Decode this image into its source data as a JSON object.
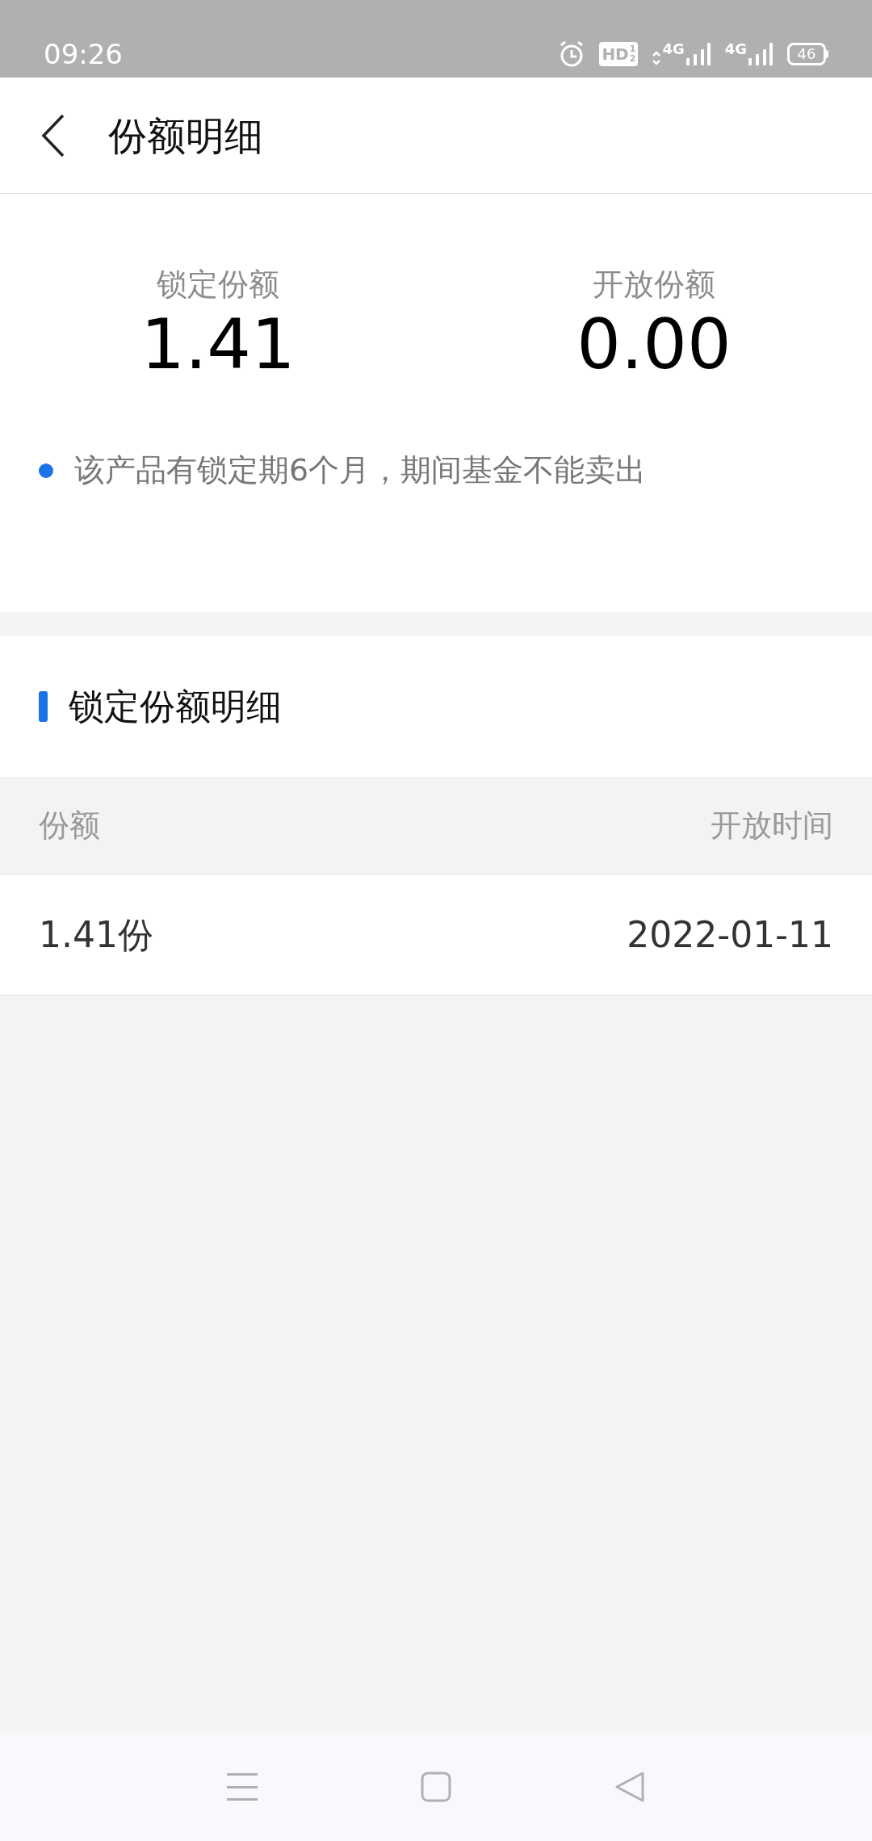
{
  "status_bar": {
    "time": "09:26",
    "hd_badge": "HD",
    "hd_sims": [
      "1",
      "2"
    ],
    "networks": [
      "4G",
      "4G"
    ],
    "battery": "46"
  },
  "header": {
    "title": "份额明细"
  },
  "summary": [
    {
      "label": "锁定份额",
      "value": "1.41"
    },
    {
      "label": "开放份额",
      "value": "0.00"
    }
  ],
  "note": {
    "text": "该产品有锁定期6个月，期间基金不能卖出",
    "color": "#1a73e8"
  },
  "section": {
    "title": "锁定份额明细"
  },
  "table": {
    "columns": [
      "份额",
      "开放时间"
    ],
    "rows": [
      [
        "1.41份",
        "2022-01-11"
      ]
    ]
  }
}
